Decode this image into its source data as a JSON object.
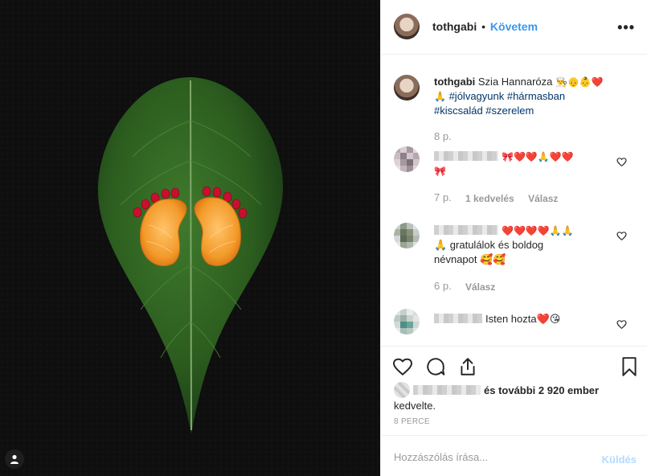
{
  "post": {
    "username": "tothgabi",
    "follow_label": "Követem",
    "more_label": "•••",
    "header_dot": "•"
  },
  "caption": {
    "username": "tothgabi",
    "text": "Szia Hannaróza",
    "emojis_line1": "👨‍🍳👴👶❤️",
    "emoji_pray": "🙏",
    "tags_line1": "#jólvagyunk #hármasban",
    "tags_line2": "#kiscsalád #szerelem",
    "time": "8 p."
  },
  "comments": [
    {
      "emojis": "🎀❤️❤️🙏❤️❤️",
      "emojis_line2": "🎀",
      "time": "7 p.",
      "likes": "1 kedvelés",
      "reply": "Válasz"
    },
    {
      "emojis": "❤️❤️❤️❤️🙏🙏",
      "text_line1": "🙏 gratulálok és boldog",
      "text_line2": "névnapot 🥰🥰",
      "time": "6 p.",
      "reply": "Válasz"
    },
    {
      "text": "Isten hozta❤️😘"
    }
  ],
  "likes": {
    "text": "és további 2 920 ember",
    "text2": "kedvelte."
  },
  "post_time": "8 PERCE",
  "composer": {
    "placeholder": "Hozzászólás írása...",
    "send_label": "Küldés"
  },
  "colors": {
    "accent": "#3897f0",
    "send_disabled": "#b3dbff",
    "muted": "#999999",
    "hashtag": "#003569"
  },
  "icons": {
    "like": "heart-icon",
    "comment": "comment-icon",
    "share": "share-icon",
    "save": "bookmark-icon",
    "user_tag": "user-icon"
  }
}
